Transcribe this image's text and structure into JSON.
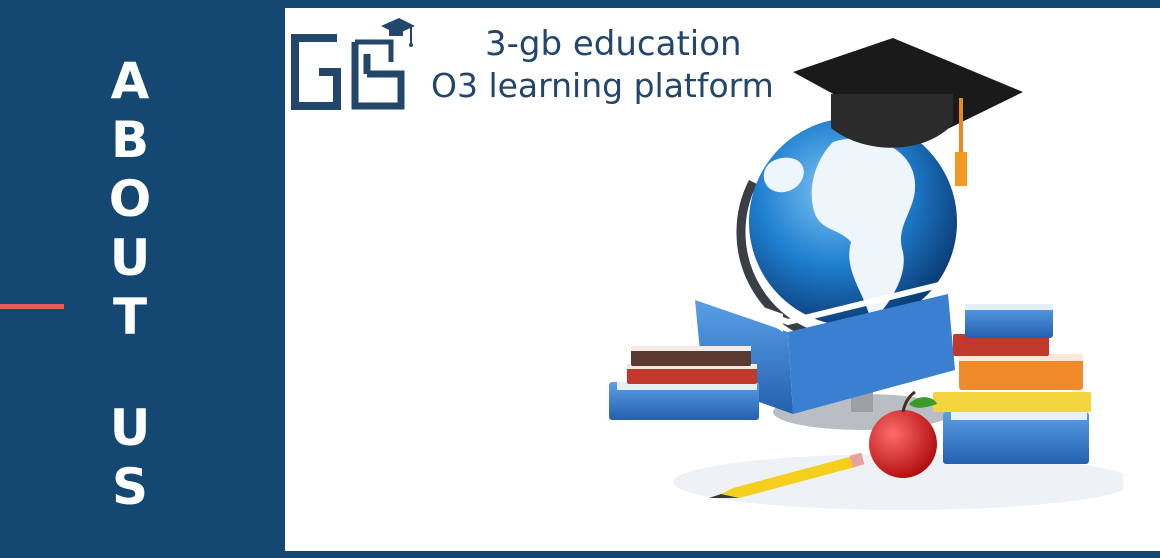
{
  "sidebar": {
    "title_letters": [
      "A",
      "B",
      "O",
      "U",
      "T",
      "",
      "U",
      "S"
    ]
  },
  "brand": {
    "logo_text": "GB",
    "line1": "3-gb education",
    "line2": "O3 learning platform"
  },
  "colors": {
    "sidebar_bg": "#144771",
    "accent": "#e9595b",
    "brand_text": "#23476a"
  },
  "icons": {
    "logo": "gb-logo-with-graduation-cap-icon",
    "illustration": "globe-books-apple-pencil-graduation-cap-icon"
  }
}
